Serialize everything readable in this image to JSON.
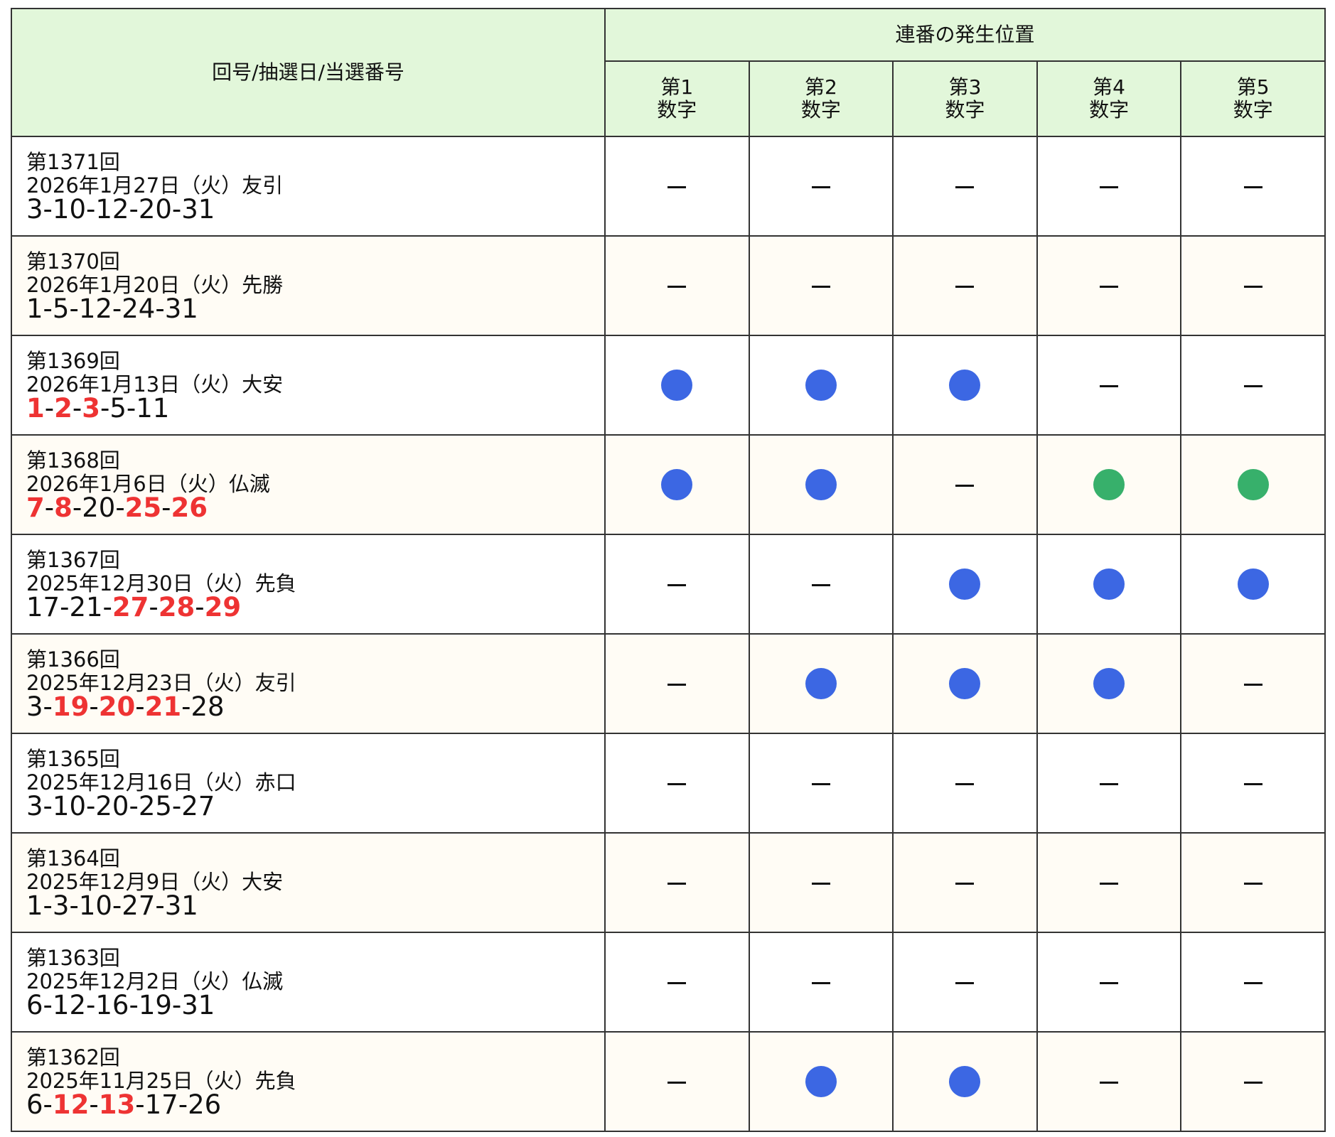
{
  "header": {
    "main_title": "回号/抽選日/当選番号",
    "positions_title": "連番の発生位置",
    "position_labels": [
      {
        "line1": "第1",
        "line2": "数字"
      },
      {
        "line1": "第2",
        "line2": "数字"
      },
      {
        "line1": "第3",
        "line2": "数字"
      },
      {
        "line1": "第4",
        "line2": "数字"
      },
      {
        "line1": "第5",
        "line2": "数字"
      }
    ]
  },
  "colors": {
    "highlight_number": "#ee3333",
    "marker_blue": "#3c67e3",
    "marker_green": "#37b06b",
    "header_bg": "#e2f7da"
  },
  "rows": [
    {
      "draw": "第1371回",
      "date": "2026年1月27日（火）友引",
      "numbers": [
        {
          "v": "3",
          "hl": false
        },
        {
          "v": "10",
          "hl": false
        },
        {
          "v": "12",
          "hl": false
        },
        {
          "v": "20",
          "hl": false
        },
        {
          "v": "31",
          "hl": false
        }
      ],
      "positions": [
        "dash",
        "dash",
        "dash",
        "dash",
        "dash"
      ]
    },
    {
      "draw": "第1370回",
      "date": "2026年1月20日（火）先勝",
      "numbers": [
        {
          "v": "1",
          "hl": false
        },
        {
          "v": "5",
          "hl": false
        },
        {
          "v": "12",
          "hl": false
        },
        {
          "v": "24",
          "hl": false
        },
        {
          "v": "31",
          "hl": false
        }
      ],
      "positions": [
        "dash",
        "dash",
        "dash",
        "dash",
        "dash"
      ]
    },
    {
      "draw": "第1369回",
      "date": "2026年1月13日（火）大安",
      "numbers": [
        {
          "v": "1",
          "hl": true
        },
        {
          "v": "2",
          "hl": true
        },
        {
          "v": "3",
          "hl": true
        },
        {
          "v": "5",
          "hl": false
        },
        {
          "v": "11",
          "hl": false
        }
      ],
      "positions": [
        "blue",
        "blue",
        "blue",
        "dash",
        "dash"
      ]
    },
    {
      "draw": "第1368回",
      "date": "2026年1月6日（火）仏滅",
      "numbers": [
        {
          "v": "7",
          "hl": true
        },
        {
          "v": "8",
          "hl": true
        },
        {
          "v": "20",
          "hl": false
        },
        {
          "v": "25",
          "hl": true
        },
        {
          "v": "26",
          "hl": true
        }
      ],
      "positions": [
        "blue",
        "blue",
        "dash",
        "green",
        "green"
      ]
    },
    {
      "draw": "第1367回",
      "date": "2025年12月30日（火）先負",
      "numbers": [
        {
          "v": "17",
          "hl": false
        },
        {
          "v": "21",
          "hl": false
        },
        {
          "v": "27",
          "hl": true
        },
        {
          "v": "28",
          "hl": true
        },
        {
          "v": "29",
          "hl": true
        }
      ],
      "positions": [
        "dash",
        "dash",
        "blue",
        "blue",
        "blue"
      ]
    },
    {
      "draw": "第1366回",
      "date": "2025年12月23日（火）友引",
      "numbers": [
        {
          "v": "3",
          "hl": false
        },
        {
          "v": "19",
          "hl": true
        },
        {
          "v": "20",
          "hl": true
        },
        {
          "v": "21",
          "hl": true
        },
        {
          "v": "28",
          "hl": false
        }
      ],
      "positions": [
        "dash",
        "blue",
        "blue",
        "blue",
        "dash"
      ]
    },
    {
      "draw": "第1365回",
      "date": "2025年12月16日（火）赤口",
      "numbers": [
        {
          "v": "3",
          "hl": false
        },
        {
          "v": "10",
          "hl": false
        },
        {
          "v": "20",
          "hl": false
        },
        {
          "v": "25",
          "hl": false
        },
        {
          "v": "27",
          "hl": false
        }
      ],
      "positions": [
        "dash",
        "dash",
        "dash",
        "dash",
        "dash"
      ]
    },
    {
      "draw": "第1364回",
      "date": "2025年12月9日（火）大安",
      "numbers": [
        {
          "v": "1",
          "hl": false
        },
        {
          "v": "3",
          "hl": false
        },
        {
          "v": "10",
          "hl": false
        },
        {
          "v": "27",
          "hl": false
        },
        {
          "v": "31",
          "hl": false
        }
      ],
      "positions": [
        "dash",
        "dash",
        "dash",
        "dash",
        "dash"
      ]
    },
    {
      "draw": "第1363回",
      "date": "2025年12月2日（火）仏滅",
      "numbers": [
        {
          "v": "6",
          "hl": false
        },
        {
          "v": "12",
          "hl": false
        },
        {
          "v": "16",
          "hl": false
        },
        {
          "v": "19",
          "hl": false
        },
        {
          "v": "31",
          "hl": false
        }
      ],
      "positions": [
        "dash",
        "dash",
        "dash",
        "dash",
        "dash"
      ]
    },
    {
      "draw": "第1362回",
      "date": "2025年11月25日（火）先負",
      "numbers": [
        {
          "v": "6",
          "hl": false
        },
        {
          "v": "12",
          "hl": true
        },
        {
          "v": "13",
          "hl": true
        },
        {
          "v": "17",
          "hl": false
        },
        {
          "v": "26",
          "hl": false
        }
      ],
      "positions": [
        "dash",
        "blue",
        "blue",
        "dash",
        "dash"
      ]
    }
  ]
}
